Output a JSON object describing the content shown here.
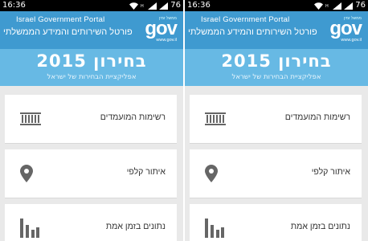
{
  "status_bar": {
    "time": "16:36",
    "battery": "76"
  },
  "portal": {
    "title_en": "Israel Government Portal",
    "title_he": "פורטל השירותים והמידע הממשלתי",
    "logo_text": "gov",
    "logo_subtext": "ממשל זמין",
    "logo_url": "www.gov.il"
  },
  "banner": {
    "title": "בחירון 2015",
    "subtitle": "אפליקציית הבחירות של ישראל"
  },
  "menu": [
    {
      "label": "רשימות המועמדים",
      "icon": "ballot-box-icon"
    },
    {
      "label": "איתור קלפי",
      "icon": "map-pin-icon"
    },
    {
      "label": "נתונים בזמן אמת",
      "icon": "bar-chart-icon"
    }
  ],
  "colors": {
    "portal_bg": "#3f9ad0",
    "banner_bg": "#67b9e4",
    "icon": "#666666"
  }
}
